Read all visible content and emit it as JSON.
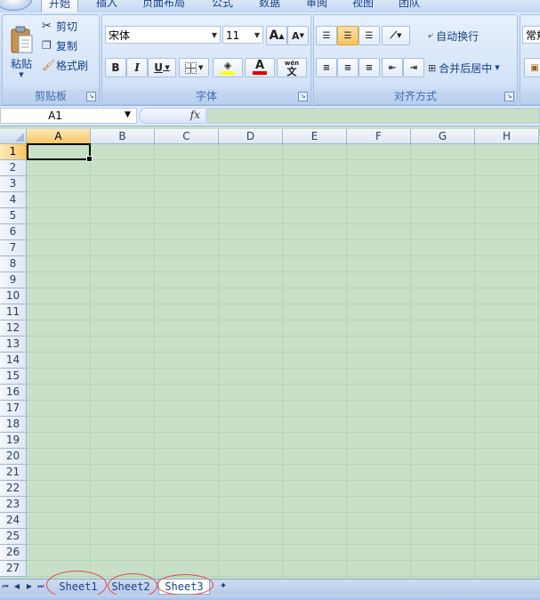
{
  "ribbon_tabs": [
    {
      "label": "开始",
      "active": true
    },
    {
      "label": "插入",
      "active": false
    },
    {
      "label": "页面布局",
      "active": false
    },
    {
      "label": "公式",
      "active": false
    },
    {
      "label": "数据",
      "active": false
    },
    {
      "label": "审阅",
      "active": false
    },
    {
      "label": "视图",
      "active": false
    },
    {
      "label": "团队",
      "active": false
    }
  ],
  "clipboard": {
    "paste_label": "粘贴",
    "cut_label": "剪切",
    "copy_label": "复制",
    "format_painter_label": "格式刷",
    "group_label": "剪贴板"
  },
  "font": {
    "font_name": "宋体",
    "font_size": "11",
    "grow_label": "A",
    "shrink_label": "A",
    "bold_label": "B",
    "italic_label": "I",
    "underline_label": "U",
    "font_color_label": "A",
    "phonetic_label": "文",
    "phonetic_top": "wén",
    "group_label": "字体"
  },
  "alignment": {
    "wrap_text_label": "自动换行",
    "merge_center_label": "合并后居中",
    "group_label": "对齐方式"
  },
  "number": {
    "format_label": "常规"
  },
  "formula_bar": {
    "name_box": "A1",
    "fx_label": "fx",
    "formula": ""
  },
  "grid": {
    "columns": [
      "A",
      "B",
      "C",
      "D",
      "E",
      "F",
      "G",
      "H"
    ],
    "rows": [
      "1",
      "2",
      "3",
      "4",
      "5",
      "6",
      "7",
      "8",
      "9",
      "10",
      "11",
      "12",
      "13",
      "14",
      "15",
      "16",
      "17",
      "18",
      "19",
      "20",
      "21",
      "22",
      "23",
      "24",
      "25",
      "26",
      "27"
    ],
    "selected_column": "A",
    "selected_row": "1"
  },
  "sheets": [
    {
      "label": "Sheet1",
      "active": false
    },
    {
      "label": "Sheet2",
      "active": false
    },
    {
      "label": "Sheet3",
      "active": true
    }
  ],
  "colors": {
    "cell_background": "#c7e0c7",
    "annotation_ring": "#e0474c",
    "selected_header": "#f9c668"
  }
}
